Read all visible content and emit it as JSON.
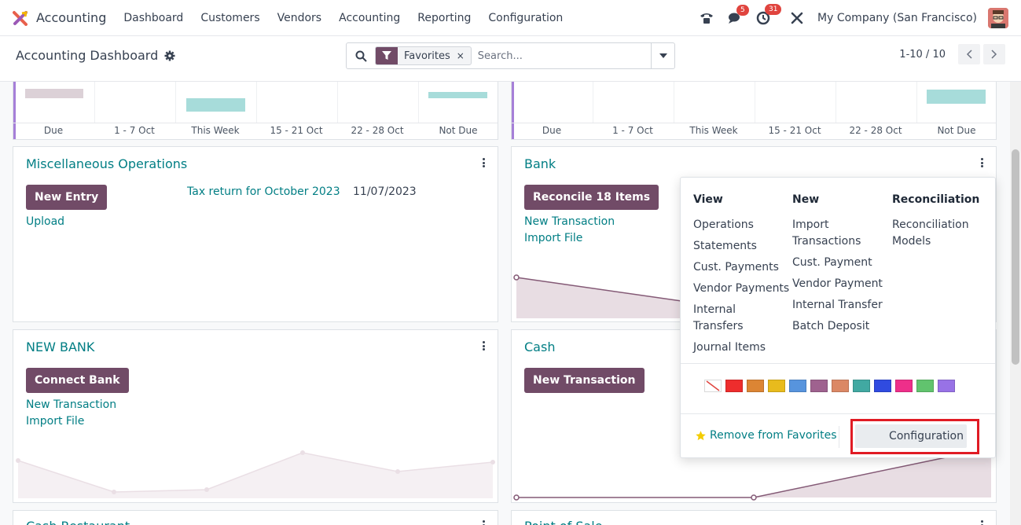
{
  "app": {
    "name": "Accounting"
  },
  "nav": {
    "items": [
      "Dashboard",
      "Customers",
      "Vendors",
      "Accounting",
      "Reporting",
      "Configuration"
    ]
  },
  "systray": {
    "messages_count": "5",
    "activities_count": "31",
    "company": "My Company (San Francisco)"
  },
  "control_panel": {
    "title": "Accounting Dashboard",
    "search": {
      "facet": "Favorites",
      "facet_remove": "×",
      "placeholder": "Search..."
    },
    "pager": "1-10 / 10"
  },
  "top_charts": {
    "labels": [
      "Due",
      "1 - 7 Oct",
      "This Week",
      "15 - 21 Oct",
      "22 - 28 Oct",
      "Not Due"
    ]
  },
  "cards": {
    "misc": {
      "title": "Miscellaneous Operations",
      "button": "New Entry",
      "upload": "Upload",
      "tax_link": "Tax return for October 2023",
      "tax_date": "11/07/2023"
    },
    "bank": {
      "title": "Bank",
      "button": "Reconcile 18 Items",
      "new_transaction": "New Transaction",
      "import_file": "Import File"
    },
    "new_bank": {
      "title": "NEW BANK",
      "button": "Connect Bank",
      "new_transaction": "New Transaction",
      "import_file": "Import File"
    },
    "cash": {
      "title": "Cash",
      "button": "New Transaction"
    },
    "cash_restaurant": {
      "title": "Cash Restaurant"
    },
    "pos": {
      "title": "Point of Sale"
    }
  },
  "dropdown": {
    "view": {
      "header": "View",
      "items": [
        "Operations",
        "Statements",
        "Cust. Payments",
        "Vendor Payments",
        "Internal Transfers",
        "Journal Items"
      ]
    },
    "new": {
      "header": "New",
      "items": [
        "Import Transactions",
        "Cust. Payment",
        "Vendor Payment",
        "Internal Transfer",
        "Batch Deposit"
      ]
    },
    "reconciliation": {
      "header": "Reconciliation",
      "items": [
        "Reconciliation Models"
      ]
    },
    "colors": [
      "#ffffff",
      "#ee2d2d",
      "#dc8534",
      "#e8bb1d",
      "#5794dd",
      "#9f628f",
      "#db8865",
      "#41a9a2",
      "#304be0",
      "#ee2f8a",
      "#61c36e",
      "#9872e6"
    ],
    "remove_favorites": "Remove from Favorites",
    "configuration": "Configuration"
  }
}
